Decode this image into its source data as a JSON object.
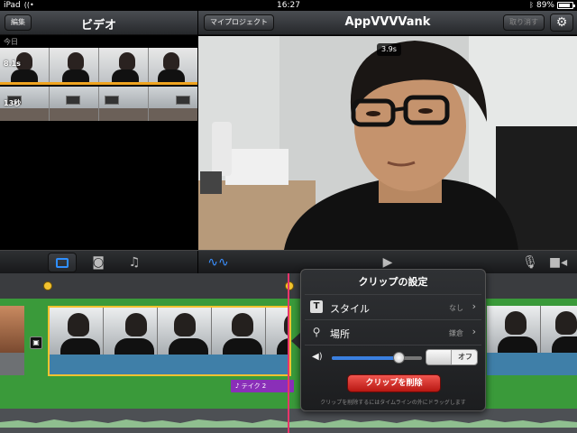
{
  "status_bar": {
    "device": "iPad",
    "time": "16:27",
    "battery": "89%",
    "battery_level": 0.89
  },
  "media_browser": {
    "edit_label": "編集",
    "title": "ビデオ",
    "section_label": "今日",
    "clips": [
      {
        "duration": "8.1s"
      },
      {
        "duration": "13秒"
      }
    ]
  },
  "viewer": {
    "project_button": "マイプロジェクト",
    "title": "AppVVVVank",
    "undo_label": "取り消す",
    "time_badge": "3.9s"
  },
  "toolbar": {
    "icons": [
      "video-mode-icon",
      "camera-icon",
      "music-note-icon",
      "waveform-icon",
      "play-icon",
      "microphone-icon",
      "record-camera-icon"
    ]
  },
  "timeline": {
    "music_clip_label": "テイク 2"
  },
  "clip_settings": {
    "title": "クリップの設定",
    "style_label": "スタイル",
    "style_value": "なし",
    "location_label": "場所",
    "location_value": "鎌倉",
    "volume_level": 0.75,
    "toggle_label": "オフ",
    "delete_label": "クリップを削除",
    "hint": "クリップを削除するにはタイムラインの外にドラッグします"
  },
  "colors": {
    "accent": "#3a8fff",
    "selection": "#f2c230",
    "playhead": "#e8356b",
    "delete": "#d3261f",
    "audio_clip": "#8a2fb8"
  }
}
